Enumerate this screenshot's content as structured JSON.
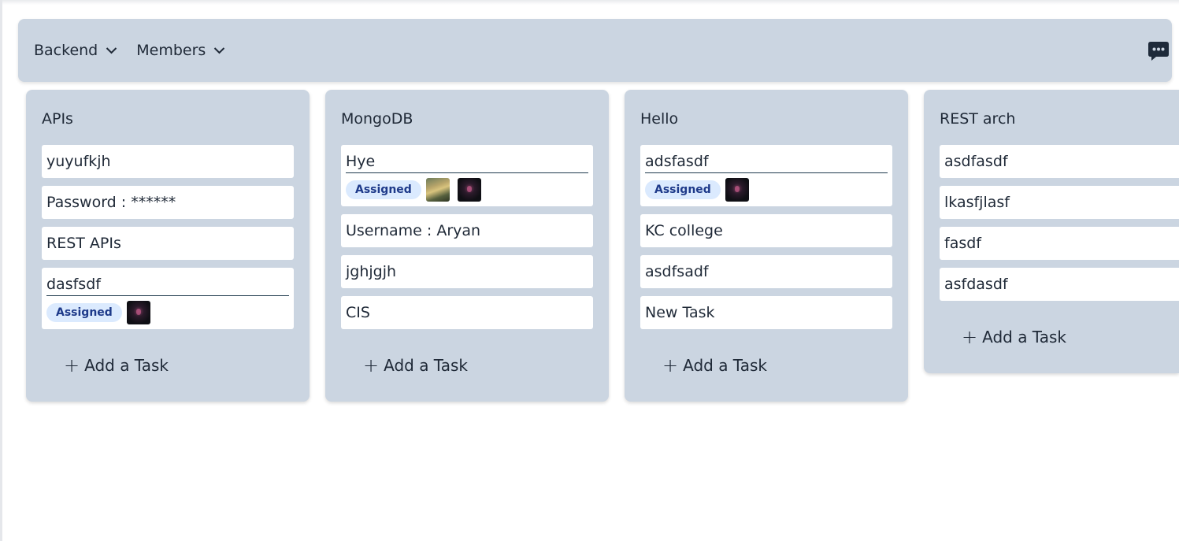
{
  "header": {
    "board_label": "Backend",
    "members_label": "Members",
    "chat_icon": "chat-bubble-icon"
  },
  "columns": [
    {
      "title": "APIs",
      "cards": [
        {
          "text": "yuyufkjh"
        },
        {
          "text": "Password : ******"
        },
        {
          "text": "REST APIs"
        },
        {
          "text": "dasfsdf",
          "badge": "Assigned",
          "avatars": [
            "space"
          ]
        }
      ],
      "add_label": "Add a Task"
    },
    {
      "title": "MongoDB",
      "cards": [
        {
          "text": "Hye",
          "badge": "Assigned",
          "avatars": [
            "landscape",
            "space"
          ]
        },
        {
          "text": "Username : Aryan"
        },
        {
          "text": "jghjgjh"
        },
        {
          "text": "CIS"
        }
      ],
      "add_label": "Add a Task"
    },
    {
      "title": "Hello",
      "cards": [
        {
          "text": "adsfasdf",
          "badge": "Assigned",
          "avatars": [
            "space"
          ]
        },
        {
          "text": "KC college"
        },
        {
          "text": "asdfsadf"
        },
        {
          "text": "New Task"
        }
      ],
      "add_label": "Add a Task"
    },
    {
      "title": "REST arch",
      "cards": [
        {
          "text": "asdfasdf"
        },
        {
          "text": "lkasfjlasf"
        },
        {
          "text": "fasdf"
        },
        {
          "text": "asfdasdf"
        }
      ],
      "add_label": "Add a Task"
    }
  ],
  "colors": {
    "panel": "#cbd5e1",
    "card": "#ffffff",
    "badge_bg": "#dbeafe",
    "badge_text": "#1e3a8a",
    "chat_icon": "#1e2a3a"
  }
}
